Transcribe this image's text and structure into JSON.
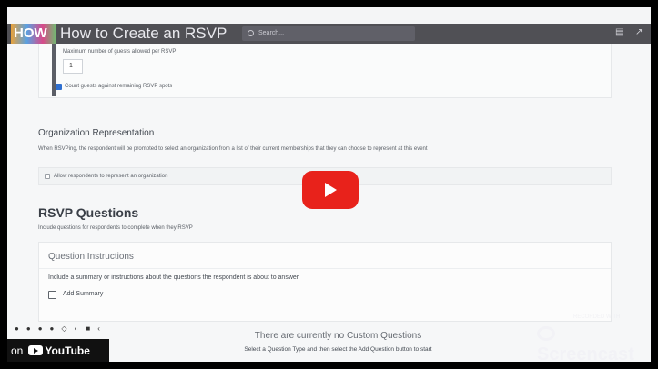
{
  "video": {
    "title": "How to Create an RSVP",
    "channel_logo_text": "HOW",
    "watch_on_prefix": "on",
    "youtube_label": "YouTube",
    "watermark": "Screencast",
    "watermark_sub": "RECORDED WITH",
    "play_icon": "play-icon"
  },
  "app": {
    "search_placeholder": "Search..."
  },
  "guests": {
    "max_label": "Maximum number of guests allowed per RSVP",
    "max_value": "1",
    "count_label": "Count guests against remaining RSVP spots",
    "count_checked": true
  },
  "organization": {
    "heading": "Organization Representation",
    "description": "When RSVPing, the respondent will be prompted to select an organization from a list of their current memberships that they can choose to represent at this event",
    "allow_label": "Allow respondents to represent an organization",
    "allow_checked": false
  },
  "rsvp_questions": {
    "heading": "RSVP Questions",
    "description": "Include questions for respondents to complete when they RSVP",
    "instructions": {
      "title": "Question Instructions",
      "description": "Include a summary or instructions about the questions the respondent is about to answer",
      "add_summary_label": "Add Summary"
    },
    "empty_title": "There are currently no Custom Questions",
    "empty_hint": "Select a Question Type and then select the Add Question button to start"
  },
  "colors": {
    "play_button": "#e8221b",
    "checkbox_accent": "#2f6fd0",
    "top_bar": "#505055"
  }
}
